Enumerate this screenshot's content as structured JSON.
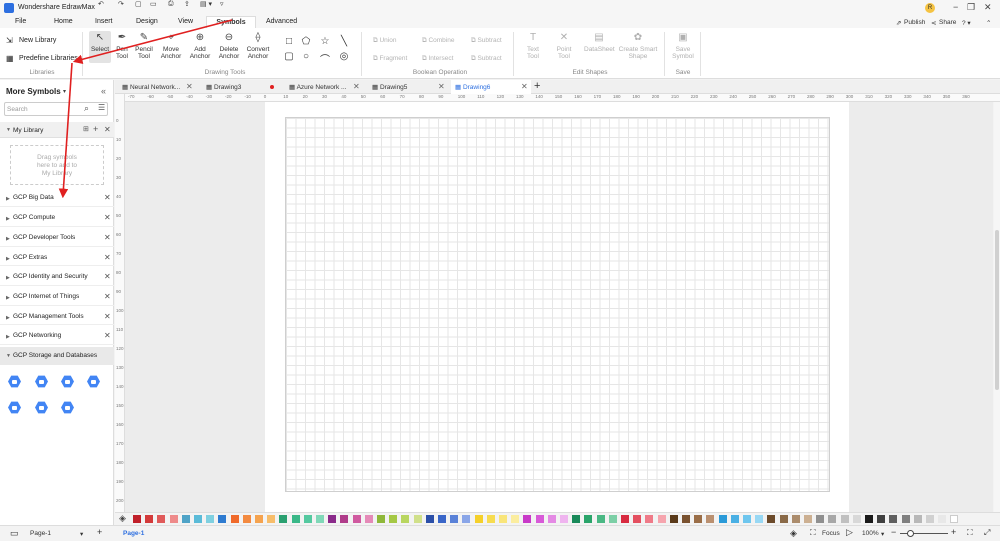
{
  "titlebar": {
    "app_title": "Wondershare EdrawMax",
    "avatar_letter": "R",
    "publish": "Publish",
    "share": "Share"
  },
  "menu": {
    "items": [
      "File",
      "Home",
      "Insert",
      "Design",
      "View",
      "Symbols",
      "Advanced"
    ],
    "active": "Symbols"
  },
  "ribbon": {
    "libraries": {
      "new_library": "New Library",
      "predefine": "Predefine Libraries",
      "label": "Libraries"
    },
    "drawing_tools": {
      "label": "Drawing Tools",
      "tools": [
        {
          "name": "Select",
          "icon": "select-arrow-icon"
        },
        {
          "name": "Pen\nTool",
          "icon": "pen-icon"
        },
        {
          "name": "Pencil\nTool",
          "icon": "pencil-icon"
        },
        {
          "name": "Move\nAnchor",
          "icon": "move-anchor-icon"
        },
        {
          "name": "Add\nAnchor",
          "icon": "add-anchor-icon"
        },
        {
          "name": "Delete\nAnchor",
          "icon": "delete-anchor-icon"
        },
        {
          "name": "Convert\nAnchor",
          "icon": "convert-anchor-icon"
        }
      ]
    },
    "boolean": {
      "label": "Boolean Operation",
      "items": [
        "Union",
        "Combine",
        "Subtract",
        "Fragment",
        "Intersect",
        "Subtract"
      ]
    },
    "edit_shapes": {
      "label": "Edit Shapes",
      "items": [
        "Text\nTool",
        "Point\nTool",
        "DataSheet",
        "Create Smart\nShape"
      ]
    },
    "save": {
      "label": "Save",
      "item": "Save\nSymbol"
    }
  },
  "sidebar": {
    "title": "More Symbols",
    "search_placeholder": "Search",
    "my_library": "My Library",
    "drop_hint": "Drag symbols\nhere to add to\nMy Library",
    "categories": [
      "GCP Big Data",
      "GCP Compute",
      "GCP Developer Tools",
      "GCP Extras",
      "GCP Identity and Security",
      "GCP Internet of Things",
      "GCP Management Tools",
      "GCP Networking",
      "GCP Storage and Databases"
    ]
  },
  "tabs": [
    {
      "label": "Neural Network...",
      "active": false
    },
    {
      "label": "Drawing3",
      "active": false,
      "unsaved": true
    },
    {
      "label": "Azure Network ...",
      "active": false
    },
    {
      "label": "Drawing5",
      "active": false
    },
    {
      "label": "Drawing6",
      "active": true
    }
  ],
  "ruler": {
    "h": [
      "-70",
      "-60",
      "-50",
      "-40",
      "-30",
      "-20",
      "-10",
      "0",
      "10",
      "20",
      "30",
      "40",
      "50",
      "60",
      "70",
      "80",
      "90",
      "100",
      "110",
      "120",
      "130",
      "140",
      "150",
      "160",
      "170",
      "180",
      "190",
      "200",
      "210",
      "220",
      "230",
      "240",
      "250",
      "260",
      "270",
      "280",
      "290",
      "300",
      "310",
      "320",
      "330",
      "340",
      "350",
      "360"
    ],
    "v": [
      "0",
      "10",
      "20",
      "30",
      "40",
      "50",
      "60",
      "70",
      "80",
      "90",
      "100",
      "110",
      "120",
      "130",
      "140",
      "150",
      "160",
      "170",
      "180",
      "190",
      "200"
    ]
  },
  "palette": [
    "#c0202a",
    "#d33a3a",
    "#e05a5a",
    "#ee8a8a",
    "#4fa3c7",
    "#5bbbd8",
    "#7fd0e0",
    "#2e7bd0",
    "#f06a2a",
    "#f38a40",
    "#f5a34f",
    "#f7bd6a",
    "#2aa070",
    "#3ab888",
    "#55c9a0",
    "#80d8b8",
    "#8a2a8a",
    "#b03c8a",
    "#d05aa0",
    "#e58ab8",
    "#8fb83a",
    "#a5c845",
    "#b9d660",
    "#d0e08a",
    "#2b4fa8",
    "#3a66c8",
    "#5a82d8",
    "#8aa6e8",
    "#f5d02a",
    "#f7dc4f",
    "#f9e57a",
    "#fbed9f",
    "#c83ac8",
    "#d85ad8",
    "#e48ae4",
    "#efb4ef",
    "#1a8a5a",
    "#2aa46a",
    "#4ab884",
    "#7ccfa6",
    "#d82a40",
    "#e45060",
    "#ef7a88",
    "#f6a5ae",
    "#5a3a1a",
    "#7a5230",
    "#9a6e48",
    "#ba9070",
    "#2a9ad8",
    "#4ab0e4",
    "#6ec6ee",
    "#98d8f4",
    "#6b4a2a",
    "#8a6a48",
    "#ab8c6c",
    "#ccb092",
    "#909090",
    "#a8a8a8",
    "#c0c0c0",
    "#d8d8d8",
    "#1a1a1a",
    "#404040",
    "#606060",
    "#808080",
    "#b8b8b8",
    "#d0d0d0",
    "#e8e8e8",
    "#ffffff"
  ],
  "status": {
    "page_selector": "Page-1",
    "page_tab": "Page-1",
    "focus": "Focus",
    "zoom": "100%"
  }
}
